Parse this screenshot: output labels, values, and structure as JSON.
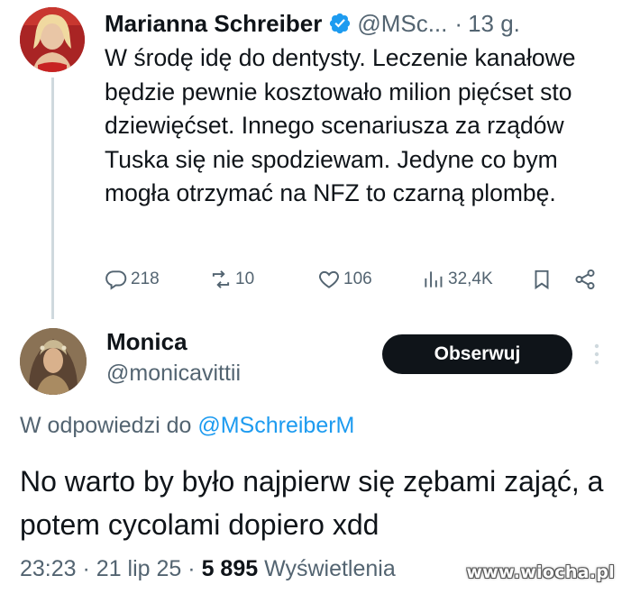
{
  "tweet": {
    "author_name": "Marianna Schreiber",
    "handle": "@MSc...",
    "separator": "·",
    "time": "13 g.",
    "text": "W środę idę do dentysty. Leczenie kanałowe będzie pewnie kosztowało milion pięćset sto dziewięćset. Innego scenariusza za rządów Tuska się nie spodziewam. Jedyne co bym mogła otrzymać na NFZ to czarną plombę.",
    "actions": {
      "replies": "218",
      "reposts": "10",
      "likes": "106",
      "views": "32,4K"
    }
  },
  "reply": {
    "author_name": "Monica",
    "handle": "@monicavittii",
    "follow_label": "Obserwuj",
    "reply_prefix": "W odpowiedzi do",
    "reply_mention": "@MSchreiberM",
    "text": "No warto by było najpierw się zębami zająć, a potem cycolami dopiero xdd",
    "meta": {
      "time": "23:23",
      "separator1": "·",
      "date": "21 lip 25",
      "separator2": "·",
      "views_count": "5 895",
      "views_label": "Wyświetlenia"
    }
  },
  "watermark": "www.wiocha.pl",
  "colors": {
    "text_primary": "#0f1419",
    "text_secondary": "#536471",
    "accent": "#1d9bf0",
    "button_bg": "#0f1419",
    "thread_line": "#cfd9de"
  },
  "icons": {
    "verified": "verified-badge-icon",
    "reply": "reply-icon",
    "repost": "repost-icon",
    "like": "heart-icon",
    "views": "views-bar-chart-icon",
    "bookmark": "bookmark-icon",
    "share": "share-icon",
    "more": "more-dots-icon"
  }
}
